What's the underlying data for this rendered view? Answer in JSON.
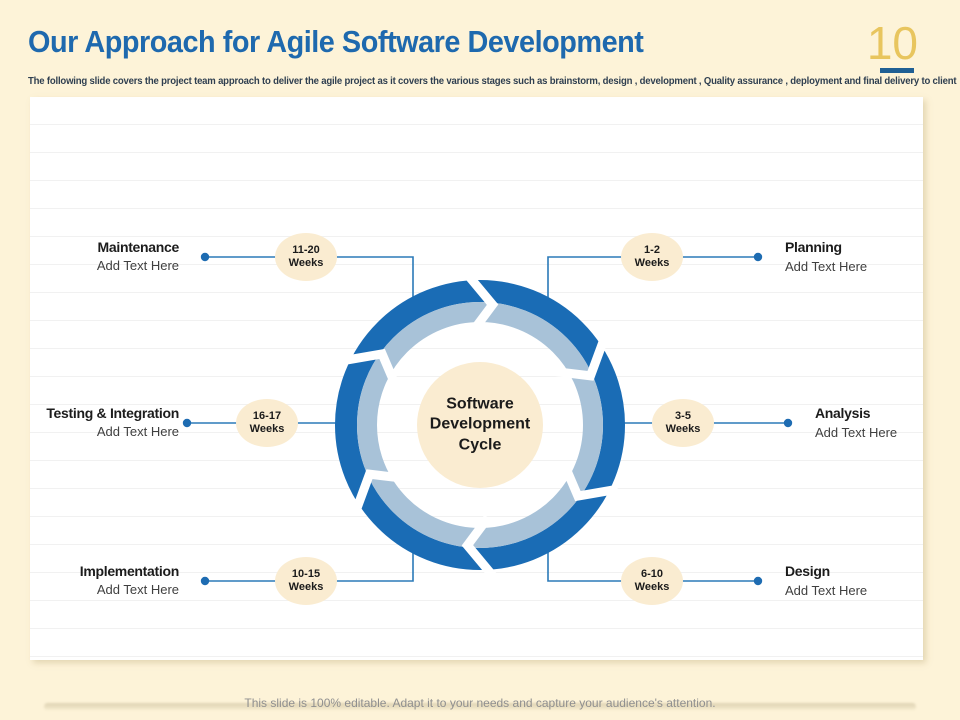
{
  "header": {
    "title": "Our Approach for Agile Software Development",
    "page_number": "10",
    "subtitle": "The following slide covers the project team approach to deliver the agile project as it covers  the various stages such as brainstorm, design , development , Quality assurance , deployment and final delivery to client"
  },
  "diagram": {
    "type": "cycle",
    "center_label": "Software Development Cycle",
    "stages": [
      {
        "name": "Maintenance",
        "placeholder": "Add Text Here",
        "duration": "11-20",
        "duration_unit": "Weeks",
        "position": "top-left"
      },
      {
        "name": "Planning",
        "placeholder": "Add Text Here",
        "duration": "1-2",
        "duration_unit": "Weeks",
        "position": "top-right"
      },
      {
        "name": "Testing & Integration",
        "placeholder": "Add Text Here",
        "duration": "16-17",
        "duration_unit": "Weeks",
        "position": "middle-left"
      },
      {
        "name": "Analysis",
        "placeholder": "Add Text Here",
        "duration": "3-5",
        "duration_unit": "Weeks",
        "position": "middle-right"
      },
      {
        "name": "Implementation",
        "placeholder": "Add Text Here",
        "duration": "10-15",
        "duration_unit": "Weeks",
        "position": "bottom-left"
      },
      {
        "name": "Design",
        "placeholder": "Add Text Here",
        "duration": "6-10",
        "duration_unit": "Weeks",
        "position": "bottom-right"
      }
    ]
  },
  "footer": {
    "text": "This slide is 100% editable. Adapt it to your needs and capture your audience's attention."
  },
  "colors": {
    "background": "#fdf3d8",
    "panel": "#ffffff",
    "title": "#1e69ae",
    "page_number": "#e8c55e",
    "page_number_underline": "#1f5f94",
    "subtitle_text": "#2f3f50",
    "ring_dark_blue": "#1a6cb5",
    "ring_light_blue": "#a8c2d8",
    "center_circle": "#faecd1",
    "badge_fill": "#faecd1",
    "connector_blue": "#2b7ab8",
    "footer_text": "#8f8f8f"
  }
}
